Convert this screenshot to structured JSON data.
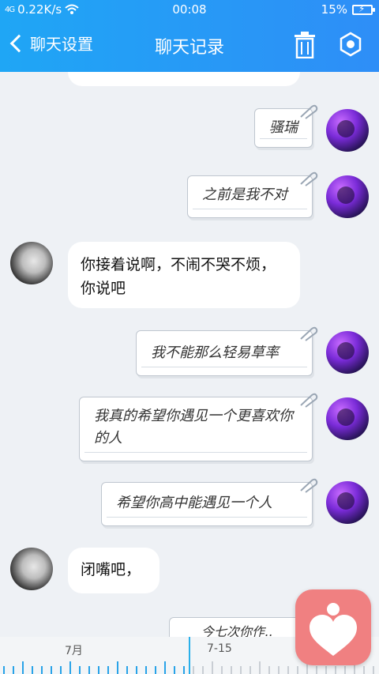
{
  "status": {
    "signal": "4G",
    "speed": "0.22K/s",
    "time": "00:08",
    "battery": "15%"
  },
  "header": {
    "back_label": "聊天设置",
    "title": "聊天记录"
  },
  "messages": [
    {
      "side": "right",
      "text": "骚瑞"
    },
    {
      "side": "right",
      "text": "之前是我不对"
    },
    {
      "side": "left",
      "text": "你接着说啊，不闹不哭不烦，你说吧"
    },
    {
      "side": "right",
      "text": "我不能那么轻易草率"
    },
    {
      "side": "right",
      "text": "我真的希望你遇见一个更喜欢你的人"
    },
    {
      "side": "right",
      "text": "希望你高中能遇见一个人"
    },
    {
      "side": "left",
      "text": "闭嘴吧，"
    },
    {
      "side": "right",
      "text": "今七次你作.."
    }
  ],
  "timeline": {
    "month_label": "7月",
    "date_label": "7-15"
  },
  "colors": {
    "header": "#2196f3",
    "accent": "#29a3e8",
    "heart_button": "#f08081"
  }
}
